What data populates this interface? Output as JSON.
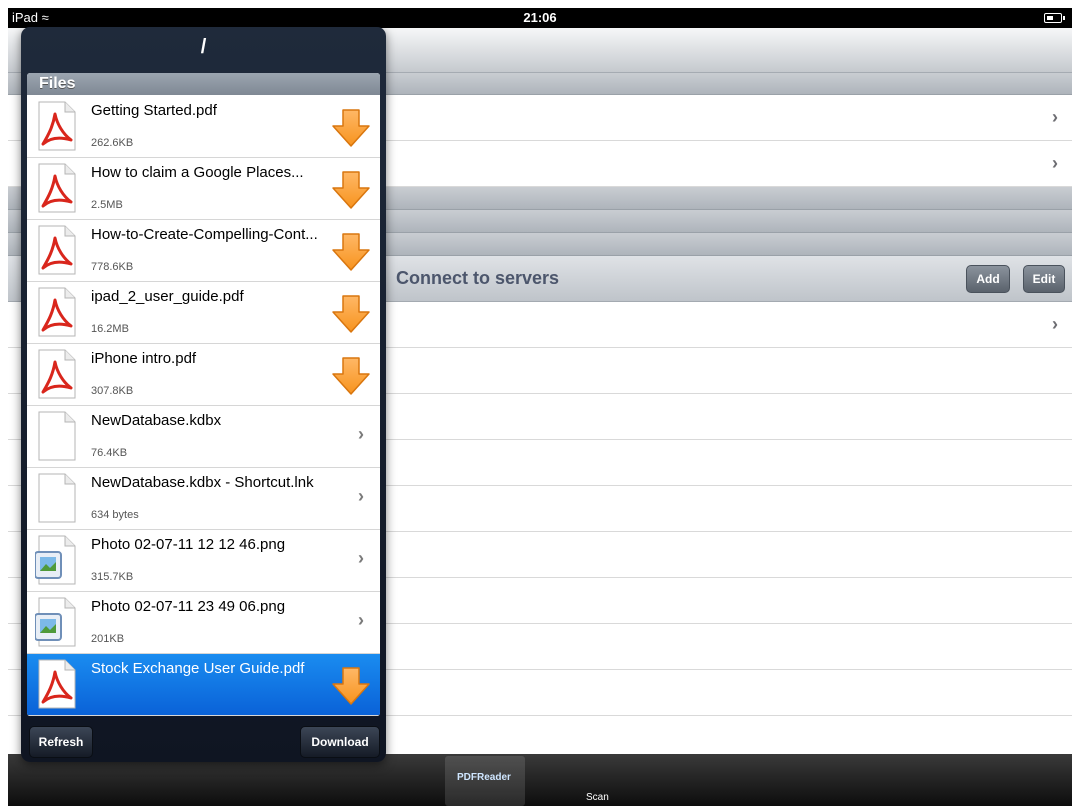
{
  "status_bar": {
    "device": "iPad",
    "time": "21:06"
  },
  "popover": {
    "title": "/",
    "section_header": "Files",
    "files": [
      {
        "name": "Getting Started.pdf",
        "size": "262.6KB",
        "type": "pdf",
        "action": "download"
      },
      {
        "name": "How to claim a Google Places...",
        "size": "2.5MB",
        "type": "pdf",
        "action": "download"
      },
      {
        "name": "How-to-Create-Compelling-Cont...",
        "size": "778.6KB",
        "type": "pdf",
        "action": "download"
      },
      {
        "name": "ipad_2_user_guide.pdf",
        "size": "16.2MB",
        "type": "pdf",
        "action": "download"
      },
      {
        "name": "iPhone intro.pdf",
        "size": "307.8KB",
        "type": "pdf",
        "action": "download"
      },
      {
        "name": "NewDatabase.kdbx",
        "size": "76.4KB",
        "type": "generic",
        "action": "open"
      },
      {
        "name": "NewDatabase.kdbx - Shortcut.lnk",
        "size": "634 bytes",
        "type": "generic",
        "action": "open"
      },
      {
        "name": "Photo 02-07-11 12 12 46.png",
        "size": "315.7KB",
        "type": "image",
        "action": "open"
      },
      {
        "name": "Photo 02-07-11 23 49 06.png",
        "size": "201KB",
        "type": "image",
        "action": "open"
      },
      {
        "name": "Stock Exchange User Guide.pdf",
        "size": "",
        "type": "pdf",
        "action": "download",
        "selected": true
      }
    ],
    "refresh_label": "Refresh",
    "download_label": "Download"
  },
  "background": {
    "section_title": "Connect to servers",
    "add_label": "Add",
    "edit_label": "Edit"
  },
  "tab_bar": {
    "tabs": [
      {
        "label": "PDFReader",
        "selected": true
      },
      {
        "label": "Scan"
      }
    ]
  },
  "colors": {
    "selection": "#0a62d8",
    "download_arrow": "#f7931e",
    "popover": "#1a2332"
  }
}
